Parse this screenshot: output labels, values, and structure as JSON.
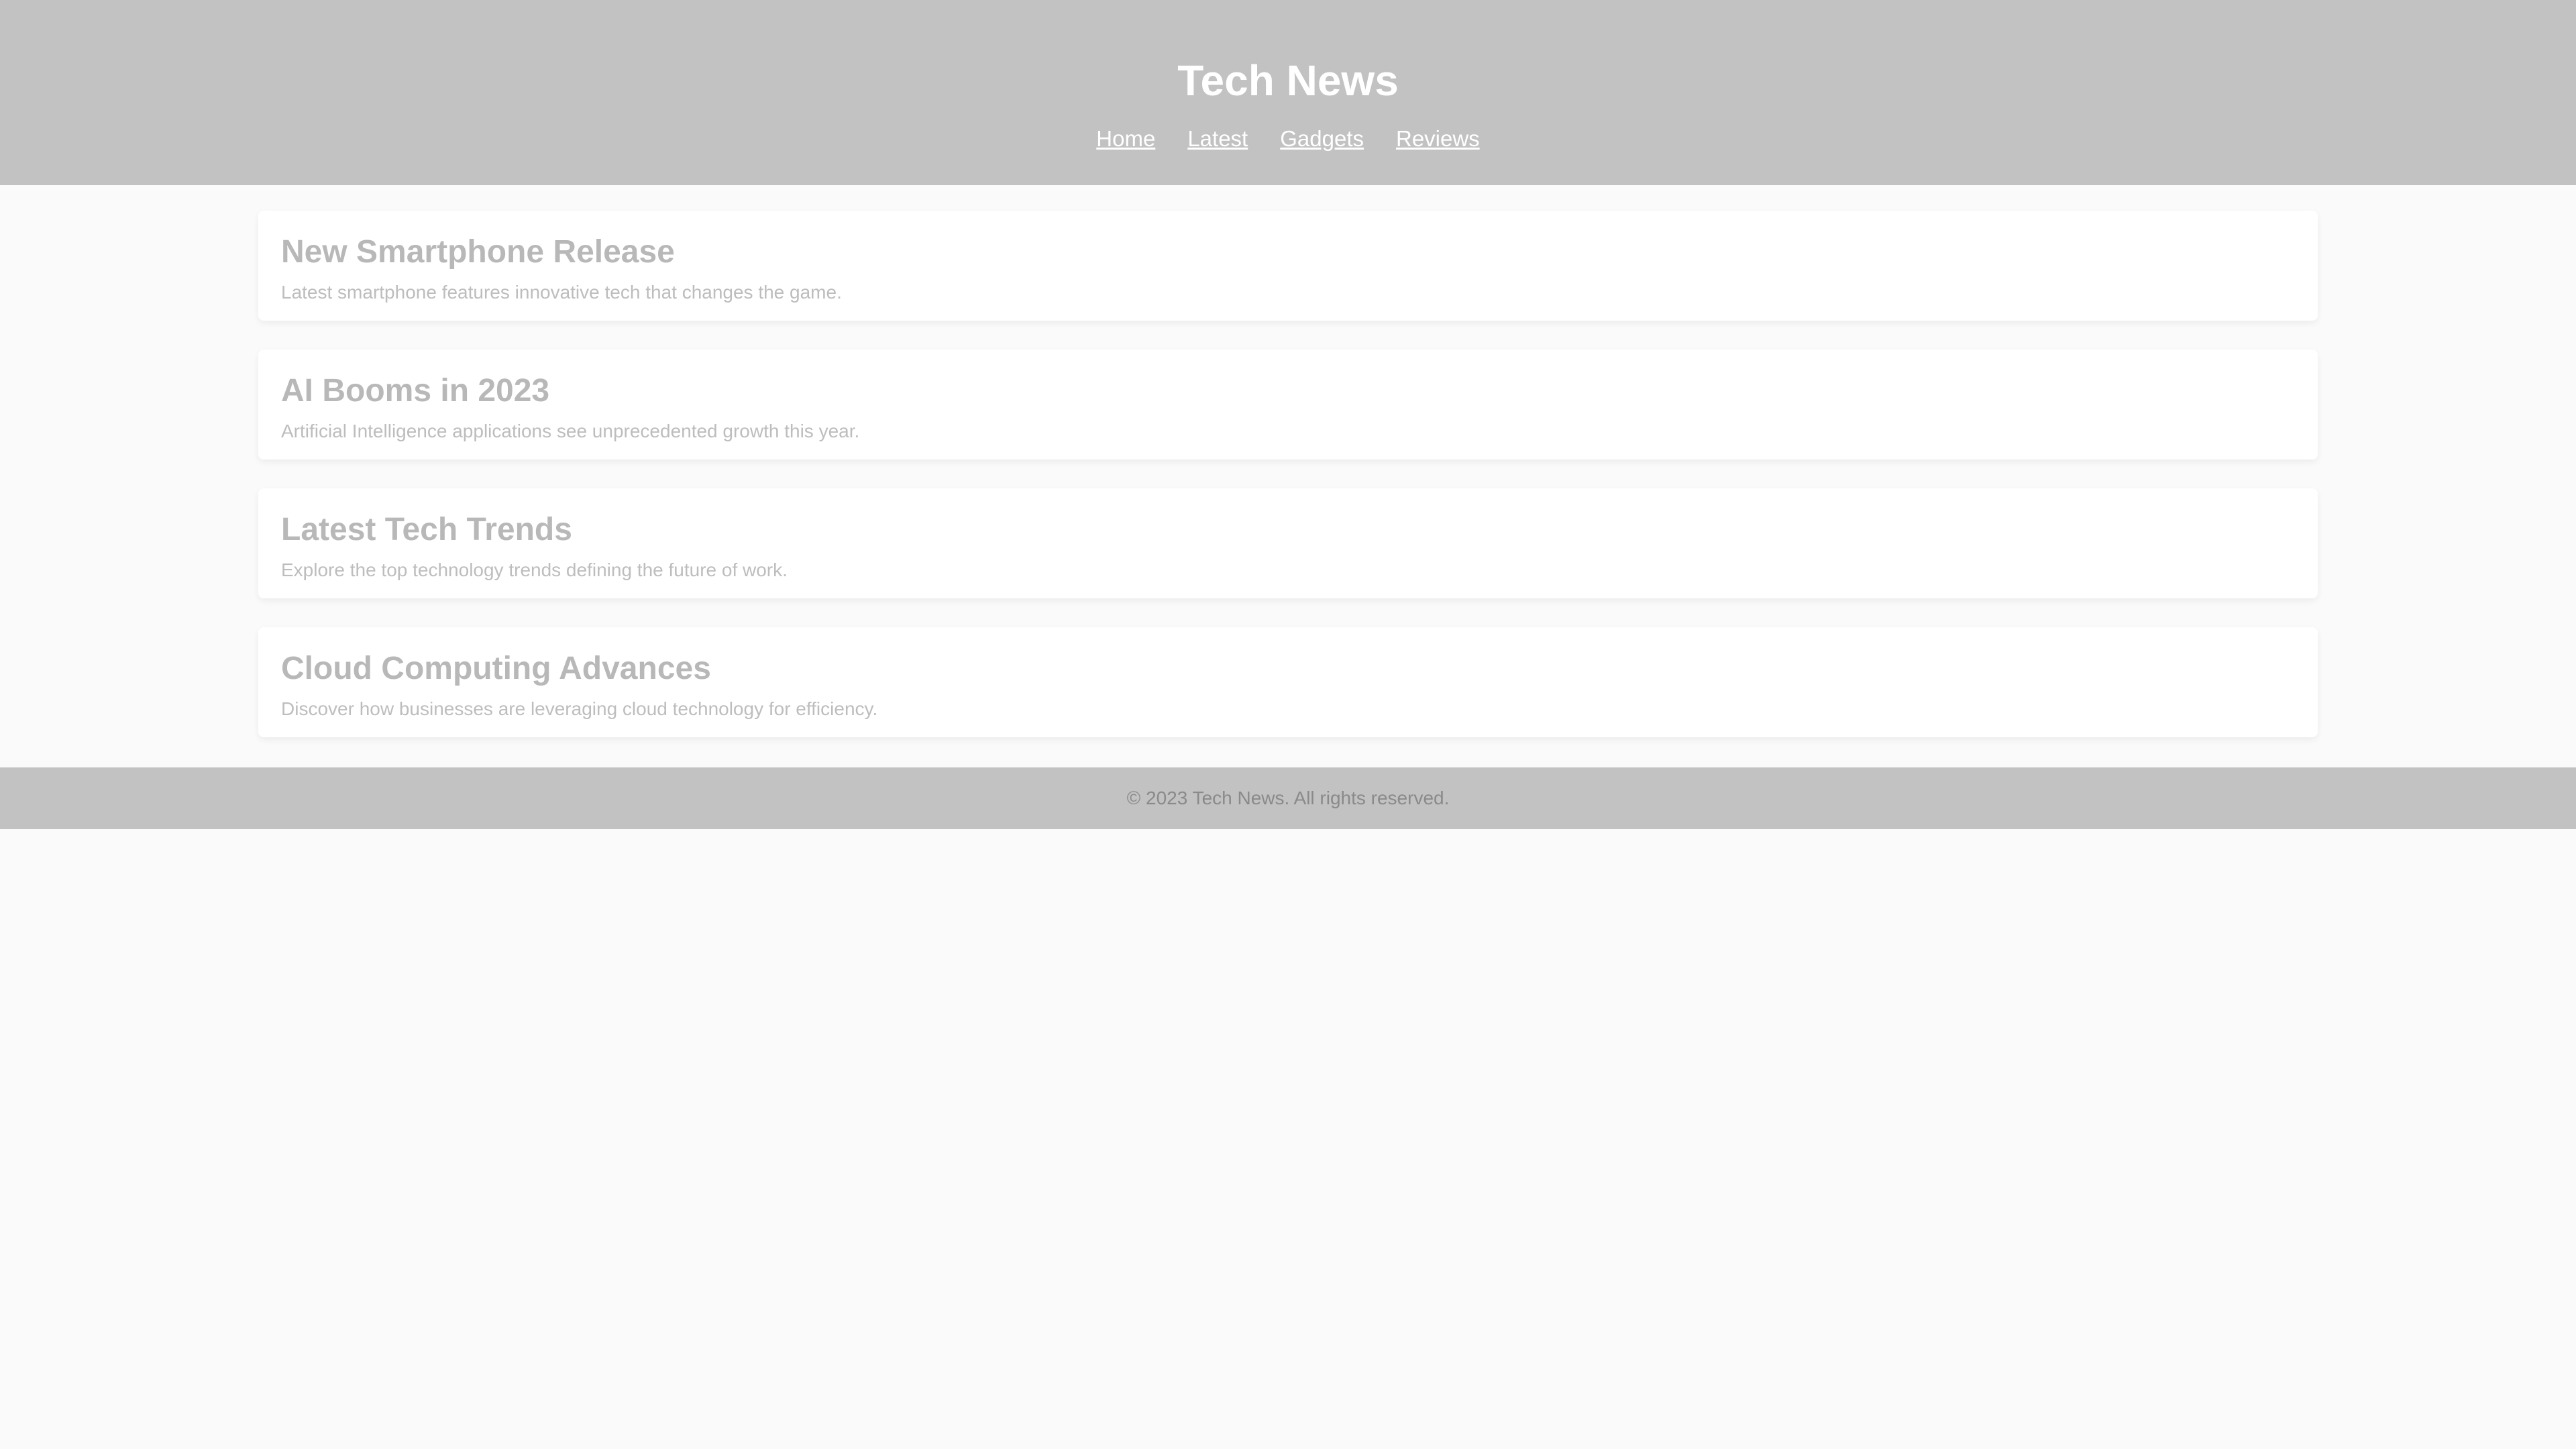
{
  "site": {
    "title": "Tech News"
  },
  "nav": {
    "items": [
      {
        "label": "Home"
      },
      {
        "label": "Latest"
      },
      {
        "label": "Gadgets"
      },
      {
        "label": "Reviews"
      }
    ]
  },
  "articles": [
    {
      "title": "New Smartphone Release",
      "summary": "Latest smartphone features innovative tech that changes the game."
    },
    {
      "title": "AI Booms in 2023",
      "summary": "Artificial Intelligence applications see unprecedented growth this year."
    },
    {
      "title": "Latest Tech Trends",
      "summary": "Explore the top technology trends defining the future of work."
    },
    {
      "title": "Cloud Computing Advances",
      "summary": "Discover how businesses are leveraging cloud technology for efficiency."
    }
  ],
  "footer": {
    "text": "© 2023 Tech News. All rights reserved."
  },
  "colors": {
    "header_bg": "#c2c2c2",
    "page_bg": "#fafafa",
    "card_bg": "#ffffff",
    "title_text": "#ffffff",
    "muted_text": "#b8b8b8"
  }
}
